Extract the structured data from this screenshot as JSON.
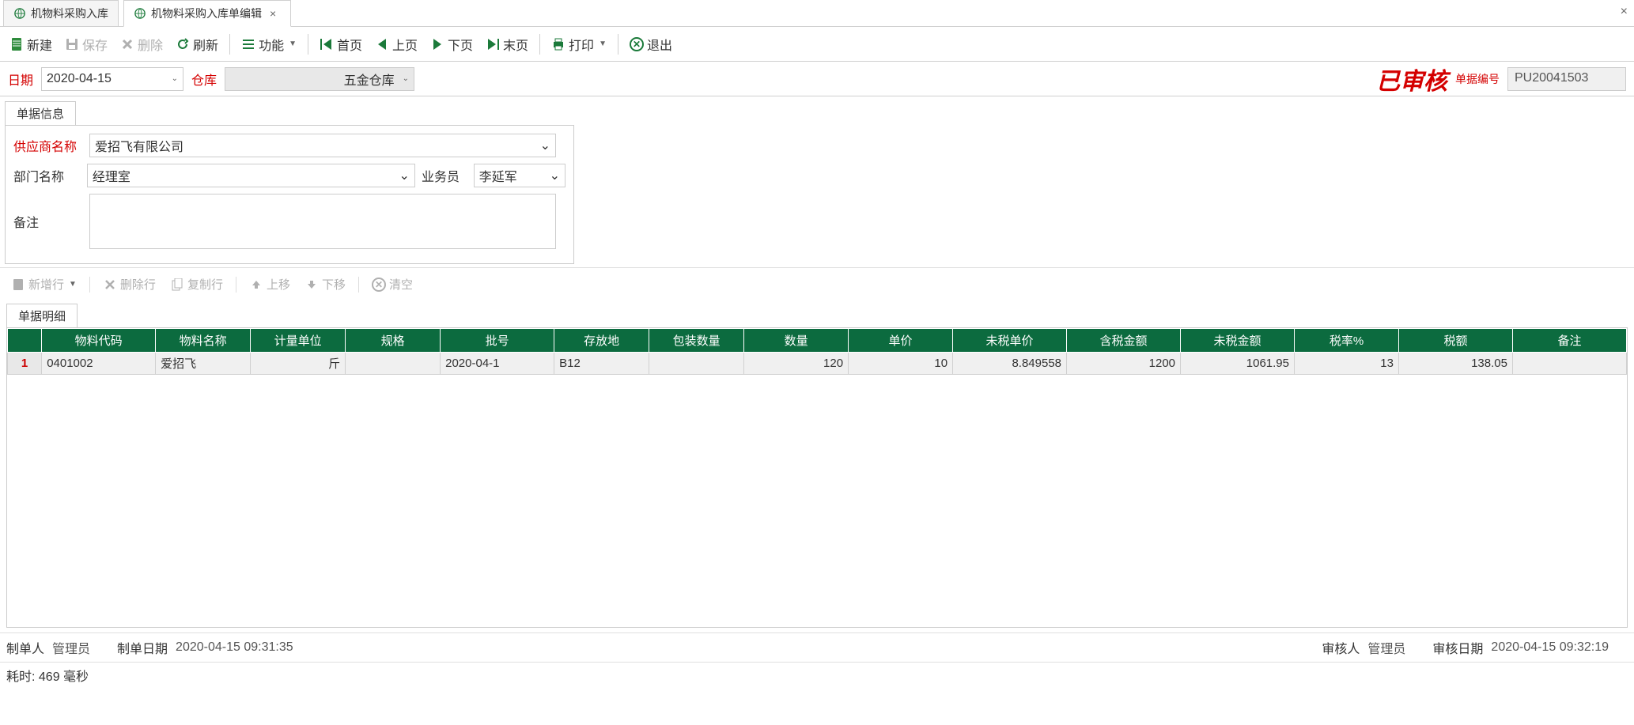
{
  "tabs": [
    {
      "label": "机物料采购入库"
    },
    {
      "label": "机物料采购入库单编辑"
    }
  ],
  "toolbar": {
    "new_label": "新建",
    "save_label": "保存",
    "delete_label": "删除",
    "refresh_label": "刷新",
    "function_label": "功能",
    "first_label": "首页",
    "prev_label": "上页",
    "next_label": "下页",
    "last_label": "末页",
    "print_label": "打印",
    "exit_label": "退出"
  },
  "header": {
    "date_label": "日期",
    "date_value": "2020-04-15",
    "warehouse_label": "仓库",
    "warehouse_value": "五金仓库",
    "stamp": "已审核",
    "docno_label": "单据编号",
    "docno_value": "PU20041503"
  },
  "info": {
    "panel_title": "单据信息",
    "supplier_label": "供应商名称",
    "supplier_value": "爱招飞有限公司",
    "dept_label": "部门名称",
    "dept_value": "经理室",
    "clerk_label": "业务员",
    "clerk_value": "李延军",
    "remark_label": "备注",
    "remark_value": ""
  },
  "row_toolbar": {
    "add_label": "新增行",
    "del_label": "删除行",
    "copy_label": "复制行",
    "up_label": "上移",
    "down_label": "下移",
    "clear_label": "清空"
  },
  "detail": {
    "tab_title": "单据明细",
    "columns": [
      "物料代码",
      "物料名称",
      "计量单位",
      "规格",
      "批号",
      "存放地",
      "包装数量",
      "数量",
      "单价",
      "未税单价",
      "含税金额",
      "未税金额",
      "税率%",
      "税额",
      "备注"
    ],
    "rows": [
      {
        "n": "1",
        "code": "0401002",
        "name": "爱招飞",
        "uom": "斤",
        "spec": "",
        "batch": "2020-04-1",
        "loc": "B12",
        "pack": "",
        "qty": "120",
        "price": "10",
        "pxprice": "8.849558",
        "txamt": "1200",
        "pxamt": "1061.95",
        "rate": "13",
        "tax": "138.05",
        "remark": ""
      }
    ]
  },
  "footer": {
    "creator_label": "制单人",
    "creator_value": "管理员",
    "create_date_label": "制单日期",
    "create_date_value": "2020-04-15 09:31:35",
    "auditor_label": "审核人",
    "auditor_value": "管理员",
    "audit_date_label": "审核日期",
    "audit_date_value": "2020-04-15 09:32:19",
    "elapsed": "耗时: 469 毫秒"
  }
}
